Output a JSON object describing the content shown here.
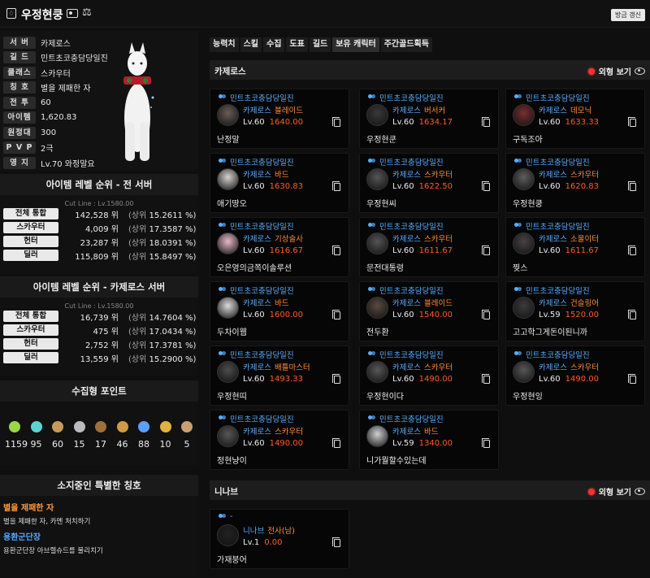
{
  "header": {
    "title": "우정현쿵",
    "refresh_label": "방금 갱신"
  },
  "profile": {
    "rows": [
      {
        "k": "서 버",
        "v": "카제로스"
      },
      {
        "k": "길 드",
        "v": "민트초코충담당일진"
      },
      {
        "k": "클래스",
        "v": "스카우터"
      },
      {
        "k": "칭 호",
        "v": "별을 제패한 자"
      },
      {
        "k": "전 투",
        "v": "60"
      },
      {
        "k": "아이템",
        "v": "1,620.83"
      },
      {
        "k": "원정대",
        "v": "300"
      },
      {
        "k": "P V P",
        "v": "2극"
      },
      {
        "k": "영 지",
        "v": "Lv.70 와정말요"
      }
    ]
  },
  "rank_all": {
    "title": "아이템 레벨 순위 - 전 서버",
    "cutline": "Cut Line : Lv.1580.00",
    "rows": [
      {
        "k": "전체 통합",
        "r": "142,528 위",
        "p1": "(상위",
        "p2": "15.2611 %)"
      },
      {
        "k": "스카우터",
        "r": "4,009 위",
        "p1": "(상위",
        "p2": "17.3587 %)"
      },
      {
        "k": "헌터",
        "r": "23,287 위",
        "p1": "(상위",
        "p2": "18.0391 %)"
      },
      {
        "k": "딜러",
        "r": "115,809 위",
        "p1": "(상위",
        "p2": "15.8497 %)"
      }
    ]
  },
  "rank_server": {
    "title": "아이템 레벨 순위 - 카제로스 서버",
    "cutline": "Cut Line : Lv.1580.00",
    "rows": [
      {
        "k": "전체 통합",
        "r": "16,739 위",
        "p1": "(상위",
        "p2": "14.7604 %)"
      },
      {
        "k": "스카우터",
        "r": "475 위",
        "p1": "(상위",
        "p2": "17.0434 %)"
      },
      {
        "k": "헌터",
        "r": "2,752 위",
        "p1": "(상위",
        "p2": "17.3781 %)"
      },
      {
        "k": "딜러",
        "r": "13,559 위",
        "p1": "(상위",
        "p2": "15.2900 %)"
      }
    ]
  },
  "collect": {
    "title": "수집형 포인트",
    "items": [
      {
        "icon": "mokoko-seed-icon",
        "color": "#9bd64b",
        "v": "1159"
      },
      {
        "icon": "island-heart-icon",
        "color": "#5fd3d0",
        "v": "95"
      },
      {
        "icon": "art-icon",
        "color": "#c89a5a",
        "v": "60"
      },
      {
        "icon": "giant-heart-icon",
        "color": "#bbbbbb",
        "v": "15"
      },
      {
        "icon": "ignea-token-icon",
        "color": "#a0703a",
        "v": "17"
      },
      {
        "icon": "adventure-book-icon",
        "color": "#d39a45",
        "v": "46"
      },
      {
        "icon": "world-tree-leaf-icon",
        "color": "#5aa0ff",
        "v": "88"
      },
      {
        "icon": "orpheus-star-icon",
        "color": "#e0b040",
        "v": "10"
      },
      {
        "icon": "omnium-star-icon",
        "color": "#c8a070",
        "v": "5"
      }
    ]
  },
  "titles": {
    "title": "소지중인 특별한 칭호",
    "items": [
      {
        "name": "별을 제패한 자",
        "desc": "별을 제패한 자, 카멘 처치하기",
        "color": "#ff9a3c"
      },
      {
        "name": "용환군단장",
        "desc": "용환군단장 아브렐슈드를 물리치기",
        "color": "#57a7ff"
      }
    ]
  },
  "tabs": [
    "능력치",
    "스킬",
    "수집",
    "도표",
    "길드",
    "보유 캐릭터",
    "주간골드획득"
  ],
  "servers": [
    {
      "name": "카제로스",
      "look_label": "외형 보기",
      "chars": [
        {
          "guild": "민트초코충담당일진",
          "srv": "카제로스",
          "cls": "블레이드",
          "lv": "Lv.60",
          "il": "1640.00",
          "nick": "난정말",
          "av": "#6b5d57"
        },
        {
          "guild": "민트초코충담당일진",
          "srv": "카제로스",
          "cls": "버서커",
          "lv": "Lv.60",
          "il": "1634.17",
          "nick": "우정현쿤",
          "av": "#3a3a3a"
        },
        {
          "guild": "민트초코충담당일진",
          "srv": "카제로스",
          "cls": "데모닉",
          "lv": "Lv.60",
          "il": "1633.33",
          "nick": "구독조아",
          "av": "#7a2e32"
        },
        {
          "guild": "민트초코충담당일진",
          "srv": "카제로스",
          "cls": "바드",
          "lv": "Lv.60",
          "il": "1630.83",
          "nick": "애기땅오",
          "av": "#d8d3cf"
        },
        {
          "guild": "민트초코충담당일진",
          "srv": "카제로스",
          "cls": "스카우터",
          "lv": "Lv.60",
          "il": "1622.50",
          "nick": "우정현씨",
          "av": "#555555"
        },
        {
          "guild": "민트초코충담당일진",
          "srv": "카제로스",
          "cls": "스카우터",
          "lv": "Lv.60",
          "il": "1620.83",
          "nick": "우정현쿵",
          "av": "#5e5e5e"
        },
        {
          "guild": "민트초코충담당일진",
          "srv": "카제로스",
          "cls": "기상술사",
          "lv": "Lv.60",
          "il": "1616.67",
          "nick": "오은영의금쪽이솔루션",
          "av": "#e7b8c8"
        },
        {
          "guild": "민트초코충담당일진",
          "srv": "카제로스",
          "cls": "스카우터",
          "lv": "Lv.60",
          "il": "1611.67",
          "nick": "문전대통령",
          "av": "#555555"
        },
        {
          "guild": "민트초코충담당일진",
          "srv": "카제로스",
          "cls": "소울이터",
          "lv": "Lv.60",
          "il": "1611.67",
          "nick": "찢스",
          "av": "#4a4244"
        },
        {
          "guild": "민트초코충담당일진",
          "srv": "카제로스",
          "cls": "바드",
          "lv": "Lv.60",
          "il": "1600.00",
          "nick": "두차이웹",
          "av": "#dcdcdc"
        },
        {
          "guild": "민트초코충담당일진",
          "srv": "카제로스",
          "cls": "블레이드",
          "lv": "Lv.60",
          "il": "1540.00",
          "nick": "전두환",
          "av": "#5a4a40"
        },
        {
          "guild": "민트초코충담당일진",
          "srv": "카제로스",
          "cls": "건슬링어",
          "lv": "Lv.59",
          "il": "1520.00",
          "nick": "고고학그게돈이된니까",
          "av": "#3c3c3c"
        },
        {
          "guild": "민트초코충담당일진",
          "srv": "카제로스",
          "cls": "배틀마스터",
          "lv": "Lv.60",
          "il": "1493.33",
          "nick": "우정현띠",
          "av": "#4c4c4c"
        },
        {
          "guild": "민트초코충담당일진",
          "srv": "카제로스",
          "cls": "스카우터",
          "lv": "Lv.60",
          "il": "1490.00",
          "nick": "우정현이다",
          "av": "#575757"
        },
        {
          "guild": "민트초코충담당일진",
          "srv": "카제로스",
          "cls": "스카우터",
          "lv": "Lv.60",
          "il": "1490.00",
          "nick": "우정현잉",
          "av": "#575757"
        },
        {
          "guild": "민트초코충담당일진",
          "srv": "카제로스",
          "cls": "스카우터",
          "lv": "Lv.60",
          "il": "1490.00",
          "nick": "정현냥이",
          "av": "#575757"
        },
        {
          "guild": "민트초코충담당일진",
          "srv": "카제로스",
          "cls": "바드",
          "lv": "Lv.59",
          "il": "1340.00",
          "nick": "니가뭘할수있는데",
          "av": "#d0d0d0"
        }
      ]
    },
    {
      "name": "니나브",
      "look_label": "외형 보기",
      "chars": [
        {
          "guild": "-",
          "srv": "니나브",
          "cls": "전사(남)",
          "lv": "Lv.1",
          "il": "0.00",
          "nick": "가재붕어",
          "av": "#222222"
        }
      ]
    }
  ]
}
